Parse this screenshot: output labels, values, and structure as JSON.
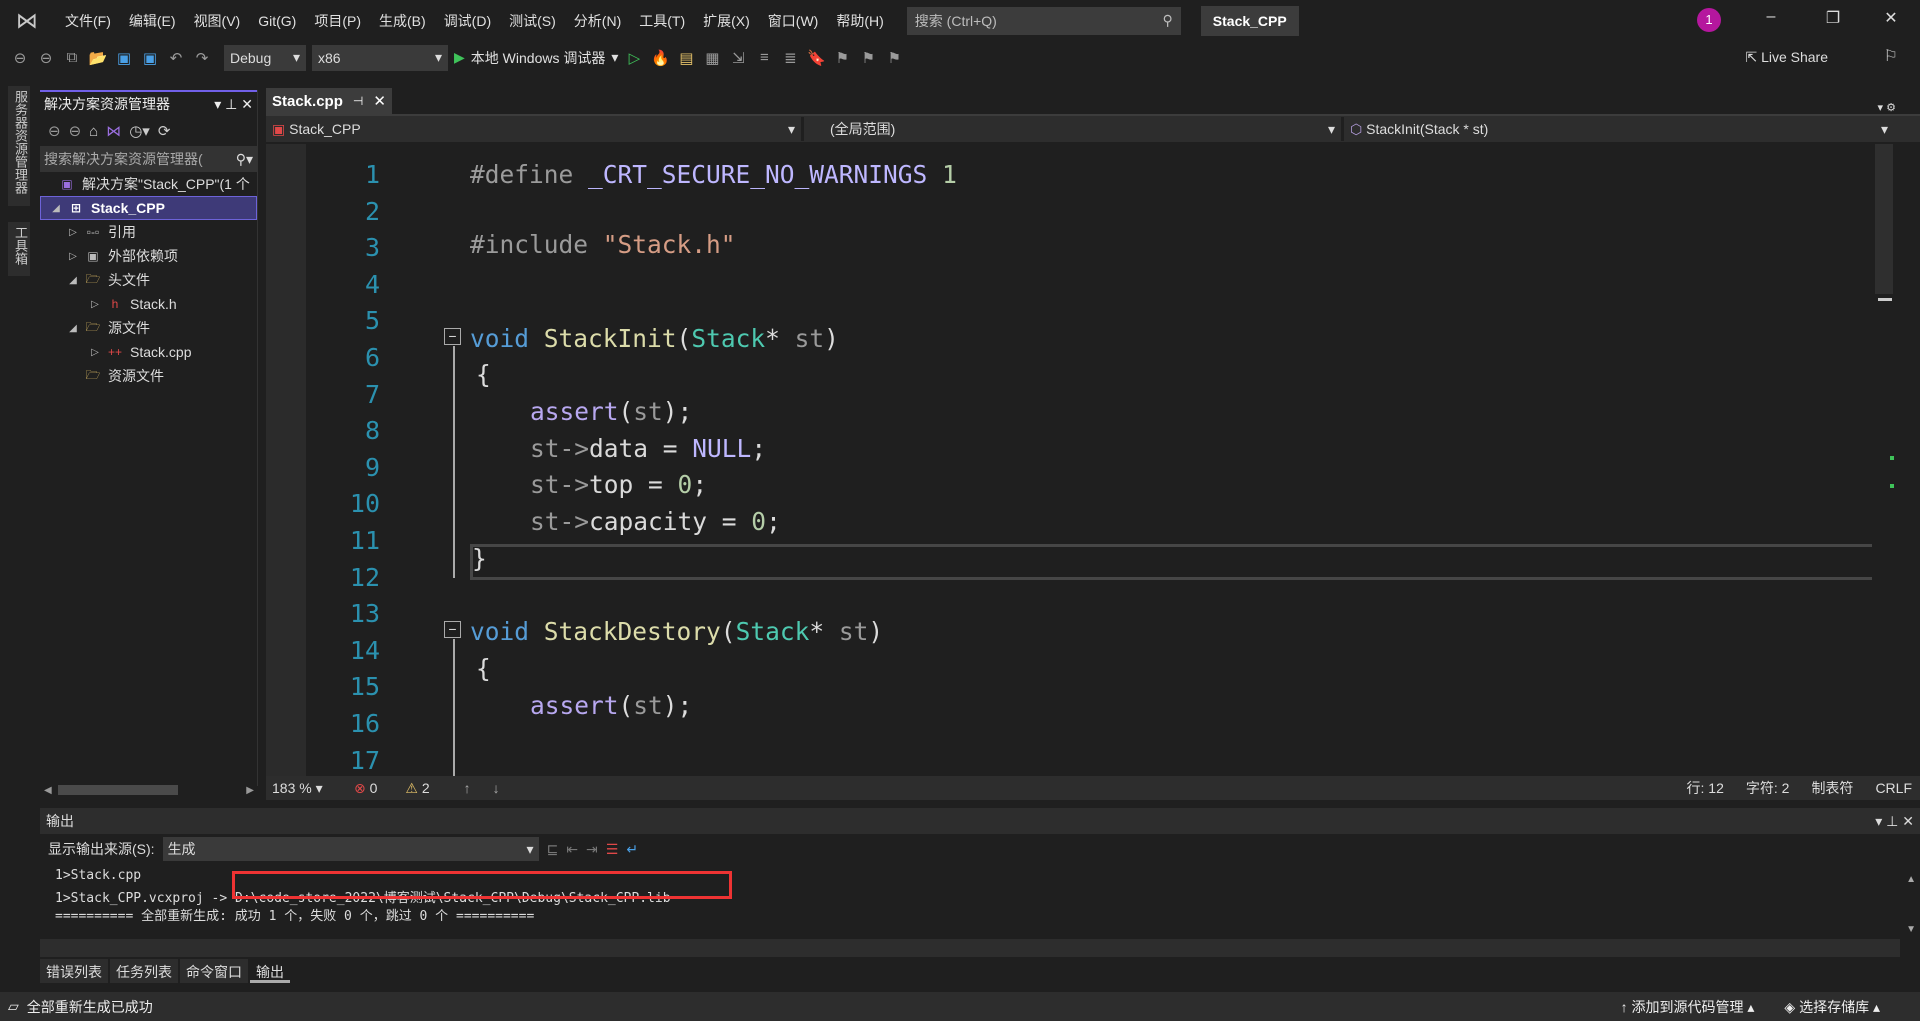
{
  "title_bar": {
    "menus": [
      "文件(F)",
      "编辑(E)",
      "视图(V)",
      "Git(G)",
      "项目(P)",
      "生成(B)",
      "调试(D)",
      "测试(S)",
      "分析(N)",
      "工具(T)",
      "扩展(X)",
      "窗口(W)",
      "帮助(H)"
    ],
    "search_placeholder": "搜索 (Ctrl+Q)",
    "project_name": "Stack_CPP",
    "notification_count": "1"
  },
  "toolbar": {
    "configuration": "Debug",
    "platform": "x86",
    "run_label": "本地 Windows 调试器",
    "live_share": "Live Share"
  },
  "side_tabs": [
    "服务器资源管理器",
    "工具箱"
  ],
  "solution_explorer": {
    "title": "解决方案资源管理器",
    "search_placeholder": "搜索解决方案资源管理器(",
    "solution_label": "解决方案\"Stack_CPP\"(1 个",
    "items": [
      {
        "label": "Stack_CPP",
        "selected": true
      },
      {
        "label": "引用"
      },
      {
        "label": "外部依赖项"
      },
      {
        "label": "头文件"
      },
      {
        "label": "Stack.h"
      },
      {
        "label": "源文件"
      },
      {
        "label": "Stack.cpp"
      },
      {
        "label": "资源文件"
      }
    ]
  },
  "editor": {
    "tab": "Stack.cpp",
    "nav_project": "Stack_CPP",
    "nav_scope": "(全局范围)",
    "nav_member": "StackInit(Stack * st)",
    "line_numbers": [
      "1",
      "2",
      "3",
      "4",
      "5",
      "6",
      "7",
      "8",
      "9",
      "10",
      "11",
      "12",
      "13",
      "14",
      "15",
      "16",
      "17"
    ],
    "code": {
      "l1_directive": "#define",
      "l1_macro": "_CRT_SECURE_NO_WARNINGS",
      "l1_value": "1",
      "l3_directive": "#include",
      "l3_file": "\"Stack.h\"",
      "void": "void",
      "fn1": "StackInit",
      "fn2": "StackDestory",
      "type": "Stack",
      "star": "*",
      "param": "st",
      "open_brace": "{",
      "close_brace": "}",
      "assert": "assert",
      "st_arrow": "st->",
      "data": "data",
      "top": "top",
      "capacity": "capacity",
      "null": "NULL",
      "zero": "0"
    },
    "status": {
      "zoom": "183 %",
      "errors": "0",
      "warnings": "2",
      "line": "行: 12",
      "char": "字符: 2",
      "indent": "制表符",
      "eol": "CRLF"
    }
  },
  "output": {
    "title": "输出",
    "source_label": "显示输出来源(S):",
    "source_value": "生成",
    "lines": [
      "1>Stack.cpp",
      "1>Stack_CPP.vcxproj -> D:\\code_store_2022\\博客测试\\Stack_CPP\\Debug\\Stack_CPP.lib",
      "========== 全部重新生成: 成功 1 个，失败 0 个，跳过 0 个 =========="
    ],
    "tabs": [
      "错误列表",
      "任务列表",
      "命令窗口",
      "输出"
    ],
    "active_tab": "输出"
  },
  "status_bar": {
    "message": "全部重新生成已成功",
    "source_control": "添加到源代码管理",
    "repo": "选择存储库"
  },
  "colors": {
    "accent": "#7160e8",
    "selection": "#3e3a78",
    "line_number": "#2b91af",
    "keyword": "#569cd6",
    "type": "#4ec9b0",
    "function": "#dcdcaa",
    "string": "#d69d85",
    "highlight_box": "#ee3333"
  }
}
